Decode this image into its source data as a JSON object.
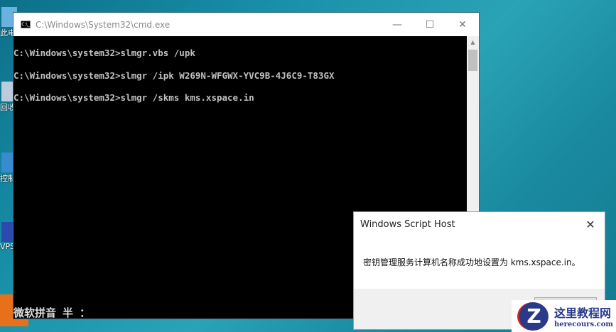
{
  "desktop": {
    "icons": [
      {
        "label": "此电脑"
      },
      {
        "label": "回收站"
      },
      {
        "label": "控制面板"
      },
      {
        "label": "VPS"
      }
    ]
  },
  "cmd": {
    "title": "C:\\Windows\\System32\\cmd.exe",
    "icon_text": "C:\\_",
    "lines": [
      "C:\\Windows\\system32>slmgr.vbs /upk",
      "C:\\Windows\\system32>slmgr /ipk W269N-WFGWX-YVC9B-4J6C9-T83GX",
      "C:\\Windows\\system32>slmgr /skms kms.xspace.in"
    ],
    "ime": "微软拼音 半 ："
  },
  "dialog": {
    "title": "Windows Script Host",
    "message": "密钥管理服务计算机名称成功地设置为 kms.xspace.in。"
  },
  "watermark": {
    "name": "这里教程网",
    "url": "herecours.com"
  }
}
